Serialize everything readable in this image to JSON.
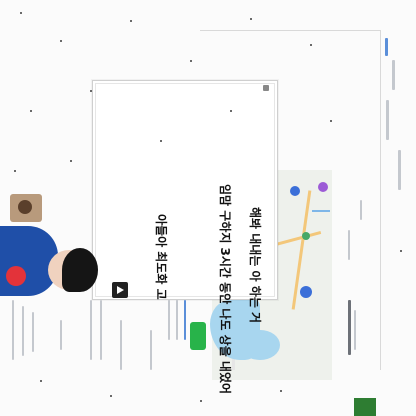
{
  "video_panel": {
    "caption_lines": [
      "아들아 최도화 고",
      "임맘 구하지 3시간 동안 나도 상을 내었어",
      "해봐 내내는 아 하는 거"
    ]
  },
  "colors": {
    "map_water": "#a8d6ef",
    "green_button": "#28b34a",
    "pin_blue": "#3b6fd8",
    "pin_purple": "#9c5bd6"
  },
  "icons": [
    "play-icon",
    "location-pin-icon",
    "person-thumbnail-icon"
  ]
}
